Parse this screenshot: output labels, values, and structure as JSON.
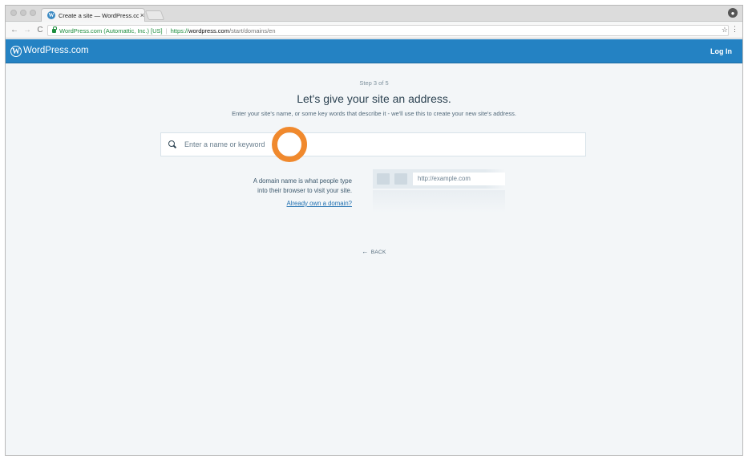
{
  "browser": {
    "tab_title": "Create a site — WordPress.co",
    "tab_close": "×",
    "secure_label": "WordPress.com (Automattic, Inc.) [US]",
    "url_scheme": "https://",
    "url_host": "wordpress.com",
    "url_path": "/start/domains/en",
    "back_glyph": "←",
    "forward_glyph": "→",
    "reload_glyph": "C",
    "star_glyph": "☆",
    "menu_glyph": "⋮"
  },
  "masterbar": {
    "logo_glyph": "W",
    "brand": "WordPress.com",
    "login": "Log In"
  },
  "signup": {
    "step": "Step 3 of 5",
    "headline": "Let's give your site an address.",
    "subheadline": "Enter your site's name, or some key words that describe it - we'll use this to create your new site's address.",
    "search_placeholder": "Enter a name or keyword",
    "search_value": "",
    "info_line1": "A domain name is what people type",
    "info_line2": "into their browser to visit your site.",
    "own_domain_link": "Already own a domain?",
    "example_url": "http://example.com",
    "back": "BACK",
    "back_glyph": "←"
  },
  "colors": {
    "masterbar": "#2482c3",
    "background": "#f3f6f8",
    "cursor_highlight": "#f0892d",
    "link": "#2271b1"
  },
  "icons": [
    "wordpress-icon",
    "lock-icon",
    "search-icon",
    "star-icon",
    "menu-icon",
    "profile-icon"
  ]
}
